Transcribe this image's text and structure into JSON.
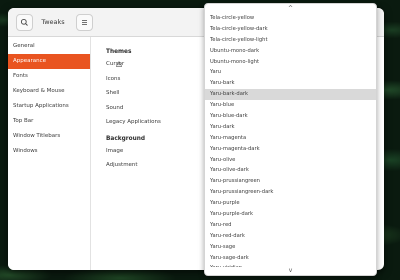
{
  "window": {
    "title": "Tweaks"
  },
  "sidebar": {
    "items": [
      {
        "label": "General",
        "active": false
      },
      {
        "label": "Appearance",
        "active": true
      },
      {
        "label": "Fonts",
        "active": false
      },
      {
        "label": "Keyboard & Mouse",
        "active": false
      },
      {
        "label": "Startup Applications",
        "active": false
      },
      {
        "label": "Top Bar",
        "active": false
      },
      {
        "label": "Window Titlebars",
        "active": false
      },
      {
        "label": "Windows",
        "active": false
      }
    ]
  },
  "themes": {
    "title": "Themes",
    "rows": [
      "Cursor",
      "Icons",
      "Shell",
      "Sound",
      "Legacy Applications"
    ]
  },
  "background": {
    "title": "Background",
    "rows": [
      "Image",
      "Adjustment"
    ]
  },
  "dropdown": {
    "up_arrow": "^",
    "down_arrow": "v",
    "selected_index": 7,
    "items": [
      "Tela-circle-yellow",
      "Tela-circle-yellow-dark",
      "Tela-circle-yellow-light",
      "Ubuntu-mono-dark",
      "Ubuntu-mono-light",
      "Yaru",
      "Yaru-bark",
      "Yaru-bark-dark",
      "Yaru-blue",
      "Yaru-blue-dark",
      "Yaru-dark",
      "Yaru-magenta",
      "Yaru-magenta-dark",
      "Yaru-olive",
      "Yaru-olive-dark",
      "Yaru-prussiangreen",
      "Yaru-prussiangreen-dark",
      "Yaru-purple",
      "Yaru-purple-dark",
      "Yaru-red",
      "Yaru-red-dark",
      "Yaru-sage",
      "Yaru-sage-dark",
      "Yaru-viridian"
    ]
  },
  "colors": {
    "accent": "#e95420",
    "selected_bg": "#d9d9d9"
  }
}
